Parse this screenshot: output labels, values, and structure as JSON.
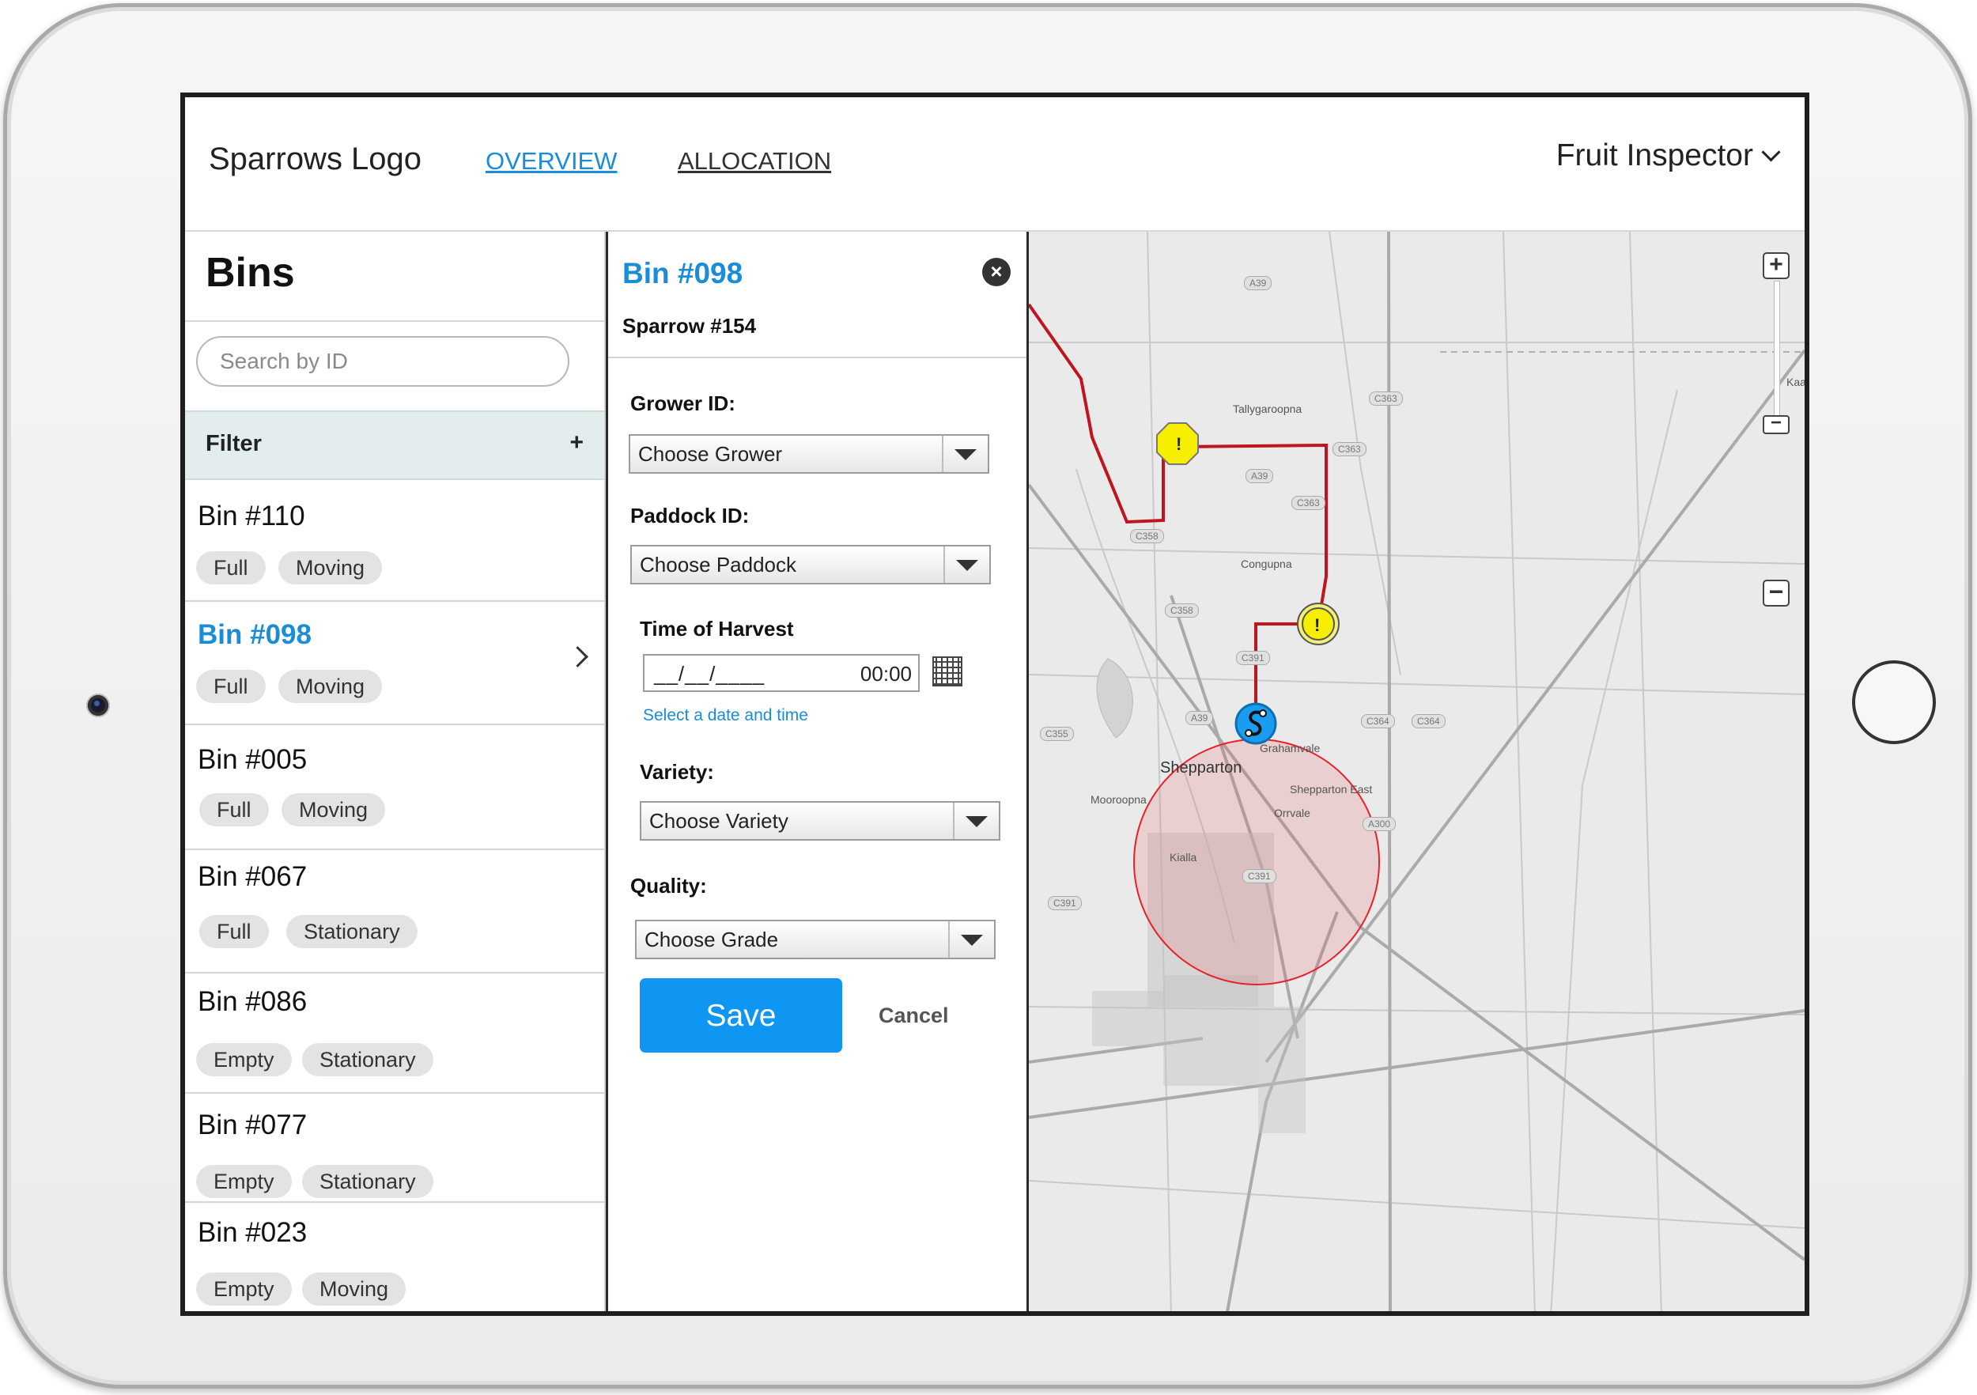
{
  "header": {
    "logo_text": "Sparrows Logo",
    "nav": [
      {
        "label": "OVERVIEW",
        "active": true
      },
      {
        "label": "ALLOCATION",
        "active": false
      }
    ],
    "user_menu_label": "Fruit Inspector"
  },
  "sidebar": {
    "title": "Bins",
    "search_placeholder": "Search by ID",
    "filter_label": "Filter",
    "filter_add": "+",
    "bins": [
      {
        "id": "Bin #110",
        "tags": [
          "Full",
          "Moving"
        ],
        "active": false
      },
      {
        "id": "Bin #098",
        "tags": [
          "Full",
          "Moving"
        ],
        "active": true
      },
      {
        "id": "Bin #005",
        "tags": [
          "Full",
          "Moving"
        ],
        "active": false
      },
      {
        "id": "Bin #067",
        "tags": [
          "Full",
          "Stationary"
        ],
        "active": false
      },
      {
        "id": "Bin #086",
        "tags": [
          "Empty",
          "Stationary"
        ],
        "active": false
      },
      {
        "id": "Bin #077",
        "tags": [
          "Empty",
          "Stationary"
        ],
        "active": false
      },
      {
        "id": "Bin #023",
        "tags": [
          "Empty",
          "Moving"
        ],
        "active": false
      }
    ]
  },
  "detail": {
    "title": "Bin #098",
    "subtitle": "Sparrow #154",
    "close_glyph": "×",
    "grower_label": "Grower ID:",
    "grower_value": "Choose Grower",
    "paddock_label": "Paddock ID:",
    "paddock_value": "Choose Paddock",
    "harvest_label": "Time of Harvest",
    "harvest_date_mask": "__/__/____",
    "harvest_time": "00:00",
    "harvest_hint": "Select a date and time",
    "variety_label": "Variety:",
    "variety_value": "Choose Variety",
    "quality_label": "Quality:",
    "quality_value": "Choose Grade",
    "save_label": "Save",
    "cancel_label": "Cancel"
  },
  "map": {
    "zoom_in": "+",
    "zoom_out": "−",
    "alert_glyph": "!",
    "places": [
      "Tallygaroopna",
      "Congupna",
      "Grahamvale",
      "Shepparton",
      "Shepparton East",
      "Mooroopna",
      "Orrvale",
      "Kialla",
      "Kaarimba"
    ],
    "road_badges": [
      "A39",
      "A39",
      "C363",
      "C363",
      "C363",
      "C358",
      "C358",
      "C355",
      "A39",
      "C364",
      "C364",
      "A300",
      "C391",
      "C391",
      "C391"
    ],
    "colors": {
      "route": "#c0141e",
      "geofence": "#e8202a",
      "alert": "#f8ef00",
      "bin_marker": "#1a9cf0"
    }
  },
  "colors": {
    "accent": "#1a8cd8",
    "save_button": "#0f96f2"
  }
}
